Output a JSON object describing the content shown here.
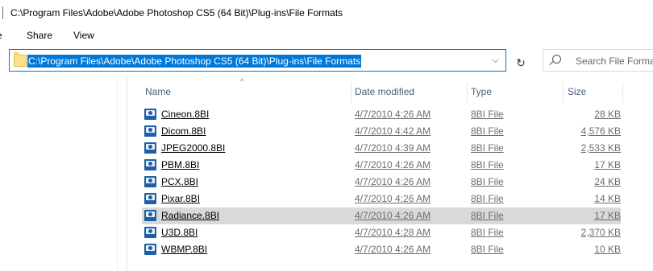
{
  "window": {
    "title": "C:\\Program Files\\Adobe\\Adobe Photoshop CS5 (64 Bit)\\Plug-ins\\File Formats"
  },
  "ribbon": {
    "tabs": [
      "e",
      "Share",
      "View"
    ]
  },
  "address": {
    "path": "C:\\Program Files\\Adobe\\Adobe Photoshop CS5 (64 Bit)\\Plug-ins\\File Formats",
    "dropdown_glyph": "⌵",
    "refresh_glyph": "↻"
  },
  "search": {
    "placeholder": "Search File Formats"
  },
  "columns": {
    "name": "Name",
    "date": "Date modified",
    "type": "Type",
    "size": "Size"
  },
  "files": [
    {
      "name": "Cineon.8BI",
      "date": "4/7/2010 4:26 AM",
      "type": "8BI File",
      "size": "28 KB"
    },
    {
      "name": "Dicom.8BI",
      "date": "4/7/2010 4:42 AM",
      "type": "8BI File",
      "size": "4,576 KB"
    },
    {
      "name": "JPEG2000.8BI",
      "date": "4/7/2010 4:39 AM",
      "type": "8BI File",
      "size": "2,533 KB"
    },
    {
      "name": "PBM.8BI",
      "date": "4/7/2010 4:26 AM",
      "type": "8BI File",
      "size": "17 KB"
    },
    {
      "name": "PCX.8BI",
      "date": "4/7/2010 4:26 AM",
      "type": "8BI File",
      "size": "24 KB"
    },
    {
      "name": "Pixar.8BI",
      "date": "4/7/2010 4:26 AM",
      "type": "8BI File",
      "size": "14 KB"
    },
    {
      "name": "Radiance.8BI",
      "date": "4/7/2010 4:26 AM",
      "type": "8BI File",
      "size": "17 KB",
      "selected": true
    },
    {
      "name": "U3D.8BI",
      "date": "4/7/2010 4:28 AM",
      "type": "8BI File",
      "size": "2,370 KB"
    },
    {
      "name": "WBMP.8BI",
      "date": "4/7/2010 4:26 AM",
      "type": "8BI File",
      "size": "10 KB"
    }
  ],
  "colors": {
    "accent": "#0078d7",
    "selected_row": "#d9d9d9",
    "header_text": "#4c607a"
  }
}
